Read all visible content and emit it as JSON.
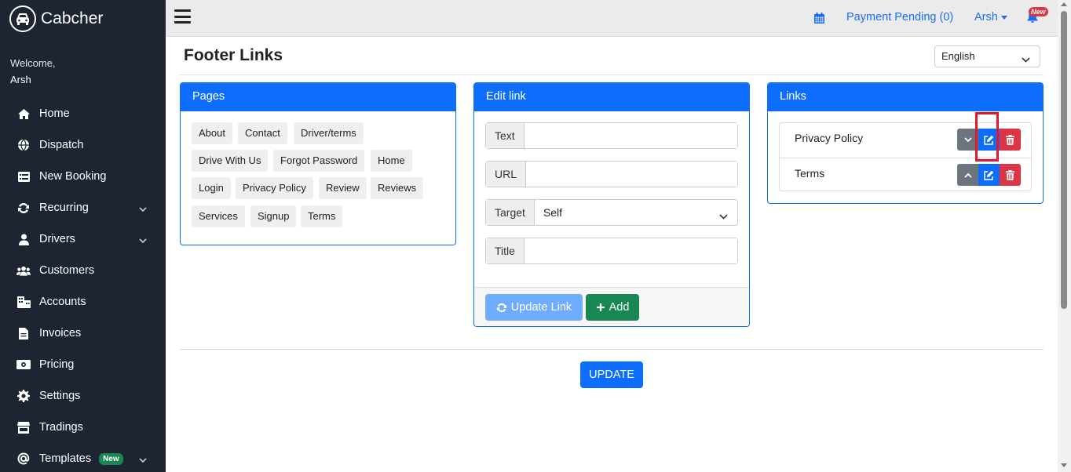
{
  "sidebar": {
    "brand": "Cabcher",
    "welcome": "Welcome,",
    "username": "Arsh",
    "items": [
      {
        "label": "Home",
        "icon": "home-icon"
      },
      {
        "label": "Dispatch",
        "icon": "globe-icon"
      },
      {
        "label": "New Booking",
        "icon": "list-icon"
      },
      {
        "label": "Recurring",
        "icon": "sync-icon",
        "has_submenu": true
      },
      {
        "label": "Drivers",
        "icon": "user-icon",
        "has_submenu": true
      },
      {
        "label": "Customers",
        "icon": "users-icon"
      },
      {
        "label": "Accounts",
        "icon": "building-icon"
      },
      {
        "label": "Invoices",
        "icon": "file-icon"
      },
      {
        "label": "Pricing",
        "icon": "money-icon"
      },
      {
        "label": "Settings",
        "icon": "gear-icon"
      },
      {
        "label": "Tradings",
        "icon": "store-icon"
      },
      {
        "label": "Templates",
        "icon": "at-icon",
        "badge": "New",
        "has_submenu": true
      }
    ]
  },
  "topbar": {
    "payment": "Payment Pending (0)",
    "user": "Arsh",
    "bell_badge": "New"
  },
  "main": {
    "title": "Footer Links",
    "language": "English",
    "update_button": "UPDATE"
  },
  "pages_card": {
    "title": "Pages",
    "pages": [
      "About",
      "Contact",
      "Driver/terms",
      "Drive With Us",
      "Forgot Password",
      "Home",
      "Login",
      "Privacy Policy",
      "Review",
      "Reviews",
      "Services",
      "Signup",
      "Terms"
    ]
  },
  "edit_card": {
    "title": "Edit link",
    "text_label": "Text",
    "text_value": "",
    "url_label": "URL",
    "url_value": "",
    "target_label": "Target",
    "target_value": "Self",
    "title_label": "Title",
    "title_value": "",
    "update_link_button": "Update Link",
    "add_button": "Add"
  },
  "links_card": {
    "title": "Links",
    "links": [
      {
        "text": "Privacy Policy",
        "move": "down"
      },
      {
        "text": "Terms",
        "move": "up"
      }
    ]
  },
  "colors": {
    "sidebar_bg": "#1d2533",
    "primary": "#0d6efd",
    "success": "#198754",
    "danger": "#dc3545",
    "secondary": "#6c757d"
  }
}
